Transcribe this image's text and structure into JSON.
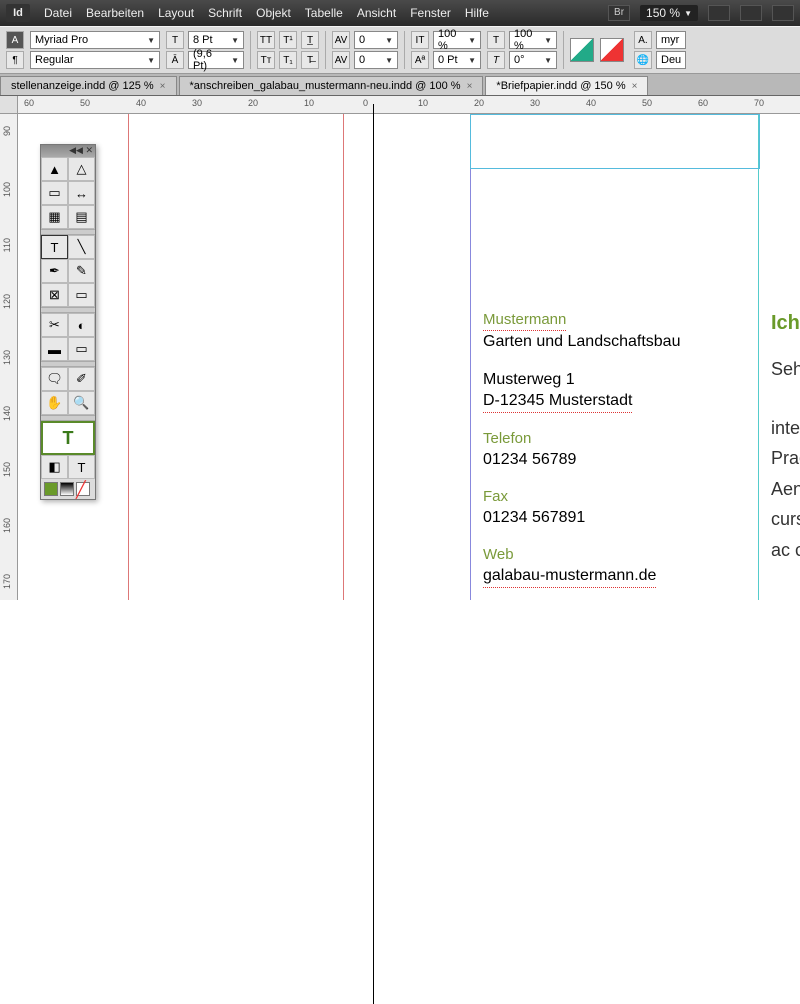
{
  "menubar": {
    "logo": "Id",
    "items": [
      "Datei",
      "Bearbeiten",
      "Layout",
      "Schrift",
      "Objekt",
      "Tabelle",
      "Ansicht",
      "Fenster",
      "Hilfe"
    ],
    "br": "Br",
    "zoom": "150 %"
  },
  "control": {
    "font": "Myriad Pro",
    "style": "Regular",
    "size_label": "T",
    "size": "8 Pt",
    "leading": "(9,6 Pt)",
    "kern": "0",
    "track": "0",
    "sx": "100 %",
    "sy": "100 %",
    "baseline": "0 Pt",
    "skew": "0°",
    "lang": "Deu",
    "search": "myr"
  },
  "tabs": [
    {
      "label": "stellenanzeige.indd @ 125 %",
      "active": false
    },
    {
      "label": "*anschreiben_galabau_mustermann-neu.indd @ 100 %",
      "active": false
    },
    {
      "label": "*Briefpapier.indd @ 150 %",
      "active": true
    }
  ],
  "ruler_h": [
    "60",
    "50",
    "40",
    "30",
    "20",
    "10",
    "0",
    "10",
    "20",
    "30",
    "40",
    "50",
    "60",
    "70"
  ],
  "ruler_v": [
    "90",
    "100",
    "110",
    "120",
    "130",
    "140",
    "150",
    "160",
    "170"
  ],
  "doc": {
    "name": "Mustermann",
    "sub": "Garten und Landschaftsbau",
    "addr1": "Musterweg 1",
    "addr2": "D-12345 Musterstadt",
    "tel_l": "Telefon",
    "tel": "01234 56789",
    "fax_l": "Fax",
    "fax": "01234 567891",
    "web_l": "Web",
    "web": "galabau-mustermann.de"
  },
  "side": {
    "title": "Ich b",
    "l1": "Sehr",
    "l2": "integ",
    "l3": "Praes",
    "l4": "Aene",
    "l5": "cursu",
    "l6": "ac cu"
  }
}
